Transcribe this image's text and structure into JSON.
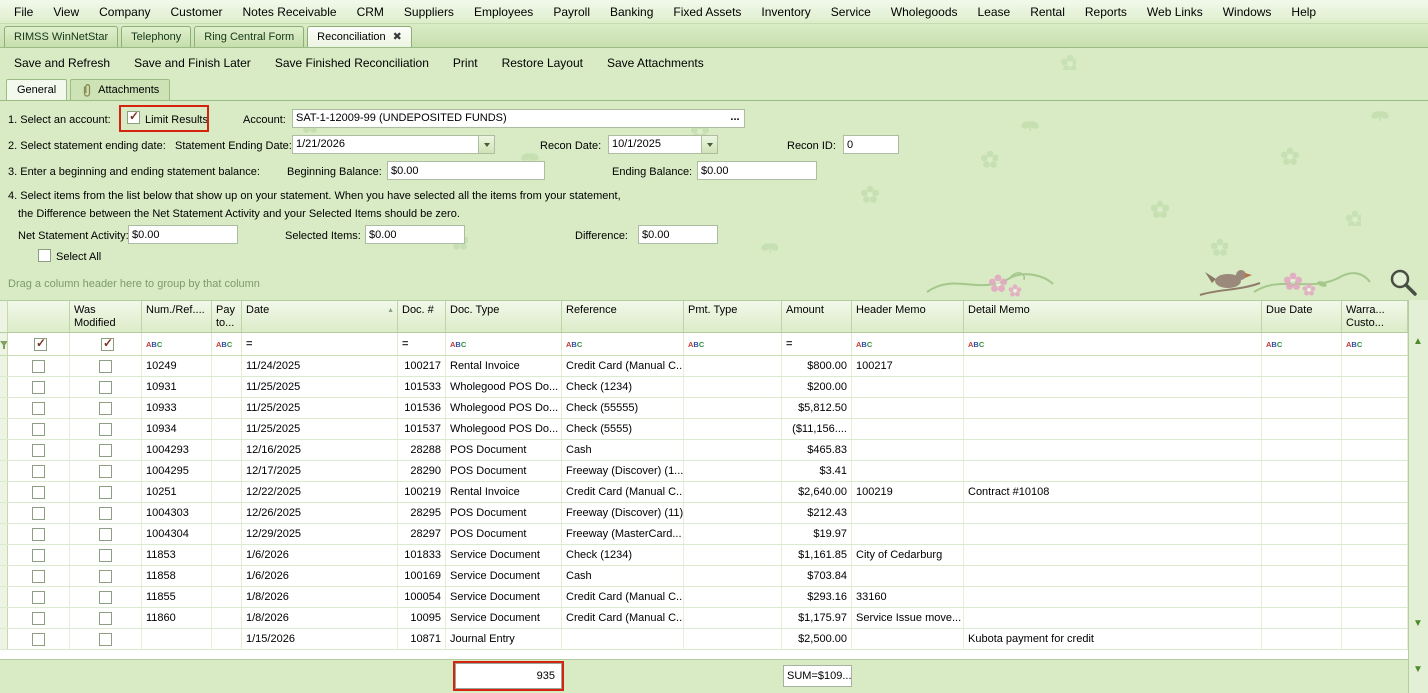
{
  "menu": {
    "items": [
      "File",
      "View",
      "Company",
      "Customer",
      "Notes Receivable",
      "CRM",
      "Suppliers",
      "Employees",
      "Payroll",
      "Banking",
      "Fixed Assets",
      "Inventory",
      "Service",
      "Wholegoods",
      "Lease",
      "Rental",
      "Reports",
      "Web Links",
      "Windows",
      "Help"
    ]
  },
  "doc_tabs": [
    {
      "label": "RIMSS WinNetStar",
      "active": false
    },
    {
      "label": "Telephony",
      "active": false
    },
    {
      "label": "Ring Central Form",
      "active": false
    },
    {
      "label": "Reconciliation",
      "active": true
    }
  ],
  "toolbar": {
    "items": [
      "Save and Refresh",
      "Save and Finish Later",
      "Save Finished Reconciliation",
      "Print",
      "Restore Layout",
      "Save Attachments"
    ]
  },
  "view_tabs": {
    "general": "General",
    "attachments": "Attachments"
  },
  "form": {
    "step1_label": "1. Select an account:",
    "limit_results_label": "Limit Results",
    "limit_results_checked": true,
    "account_label": "Account:",
    "account_value": "SAT-1-12009-99 (UNDEPOSITED FUNDS)",
    "browse_button": "...",
    "step2_label": "2. Select statement ending date:",
    "statement_ending_date_label": "Statement Ending Date:",
    "statement_ending_date_value": "1/21/2026",
    "recon_date_label": "Recon Date:",
    "recon_date_value": "10/1/2025",
    "recon_id_label": "Recon ID:",
    "recon_id_value": "0",
    "step3_label": "3. Enter a beginning and ending statement balance:",
    "beginning_balance_label": "Beginning Balance:",
    "beginning_balance_value": "$0.00",
    "ending_balance_label": "Ending Balance:",
    "ending_balance_value": "$0.00",
    "step4_line1": "4. Select items from the list below that show up on your statement. When you have selected all the items from your statement,",
    "step4_line2": "the Difference between the Net Statement Activity and your Selected Items should be zero.",
    "net_statement_activity_label": "Net Statement Activity:",
    "net_statement_activity_value": "$0.00",
    "selected_items_label": "Selected Items:",
    "selected_items_value": "$0.00",
    "difference_label": "Difference:",
    "difference_value": "$0.00",
    "select_all_label": "Select All",
    "select_all_checked": false
  },
  "grid": {
    "group_hint": "Drag a column header here to group by that column",
    "columns": [
      {
        "key": "indicator",
        "label": "",
        "filter": "funnel"
      },
      {
        "key": "sel",
        "label": "",
        "filter": "check"
      },
      {
        "key": "wasmod",
        "label": "Was Modified",
        "filter": "check"
      },
      {
        "key": "num",
        "label": "Num./Ref....",
        "filter": "abc"
      },
      {
        "key": "payto",
        "label": "Pay\nto...",
        "filter": "abc"
      },
      {
        "key": "date",
        "label": "Date",
        "filter": "eq",
        "sorted": "asc"
      },
      {
        "key": "doc",
        "label": "Doc. #",
        "filter": "eq",
        "align": "right"
      },
      {
        "key": "doc_type",
        "label": "Doc. Type",
        "filter": "abc"
      },
      {
        "key": "reference",
        "label": "Reference",
        "filter": "abc"
      },
      {
        "key": "pmt_type",
        "label": "Pmt. Type",
        "filter": "abc"
      },
      {
        "key": "amount",
        "label": "Amount",
        "filter": "eq",
        "align": "right"
      },
      {
        "key": "header_memo",
        "label": "Header Memo",
        "filter": "abc"
      },
      {
        "key": "detail_memo",
        "label": "Detail Memo",
        "filter": "abc"
      },
      {
        "key": "due_date",
        "label": "Due Date",
        "filter": "abc"
      },
      {
        "key": "warranty",
        "label": "Warra...\nCusto...",
        "filter": "abc"
      }
    ],
    "rows": [
      {
        "num": "10249",
        "date": "11/24/2025",
        "doc": "100217",
        "doc_type": "Rental Invoice",
        "reference": "Credit Card (Manual C...",
        "amount": "$800.00",
        "header_memo": "100217"
      },
      {
        "num": "10931",
        "date": "11/25/2025",
        "doc": "101533",
        "doc_type": "Wholegood POS Do...",
        "reference": "Check (1234)",
        "amount": "$200.00"
      },
      {
        "num": "10933",
        "date": "11/25/2025",
        "doc": "101536",
        "doc_type": "Wholegood POS Do...",
        "reference": "Check (55555)",
        "amount": "$5,812.50"
      },
      {
        "num": "10934",
        "date": "11/25/2025",
        "doc": "101537",
        "doc_type": "Wholegood POS Do...",
        "reference": "Check (5555)",
        "amount": "($11,156...."
      },
      {
        "num": "1004293",
        "date": "12/16/2025",
        "doc": "28288",
        "doc_type": "POS Document",
        "reference": "Cash",
        "amount": "$465.83"
      },
      {
        "num": "1004295",
        "date": "12/17/2025",
        "doc": "28290",
        "doc_type": "POS Document",
        "reference": "Freeway (Discover) (1...",
        "amount": "$3.41"
      },
      {
        "num": "10251",
        "date": "12/22/2025",
        "doc": "100219",
        "doc_type": "Rental Invoice",
        "reference": "Credit Card (Manual C...",
        "amount": "$2,640.00",
        "header_memo": "100219",
        "detail_memo": "Contract #10108"
      },
      {
        "num": "1004303",
        "date": "12/26/2025",
        "doc": "28295",
        "doc_type": "POS Document",
        "reference": "Freeway (Discover) (11)",
        "amount": "$212.43"
      },
      {
        "num": "1004304",
        "date": "12/29/2025",
        "doc": "28297",
        "doc_type": "POS Document",
        "reference": "Freeway (MasterCard...",
        "amount": "$19.97"
      },
      {
        "num": "11853",
        "date": "1/6/2026",
        "doc": "101833",
        "doc_type": "Service Document",
        "reference": "Check (1234)",
        "amount": "$1,161.85",
        "header_memo": "City of Cedarburg"
      },
      {
        "num": "11858",
        "date": "1/6/2026",
        "doc": "100169",
        "doc_type": "Service Document",
        "reference": "Cash",
        "amount": "$703.84"
      },
      {
        "num": "11855",
        "date": "1/8/2026",
        "doc": "100054",
        "doc_type": "Service Document",
        "reference": "Credit Card (Manual C...",
        "amount": "$293.16",
        "header_memo": "33160"
      },
      {
        "num": "11860",
        "date": "1/8/2026",
        "doc": "10095",
        "doc_type": "Service Document",
        "reference": "Credit Card (Manual C...",
        "amount": "$1,175.97",
        "header_memo": "Service Issue move..."
      },
      {
        "num": "",
        "date": "1/15/2026",
        "doc": "10871",
        "doc_type": "Journal Entry",
        "reference": "",
        "amount": "$2,500.00",
        "detail_memo": "Kubota payment for credit"
      }
    ],
    "footer": {
      "count": "935",
      "sum": "SUM=$109..."
    }
  }
}
